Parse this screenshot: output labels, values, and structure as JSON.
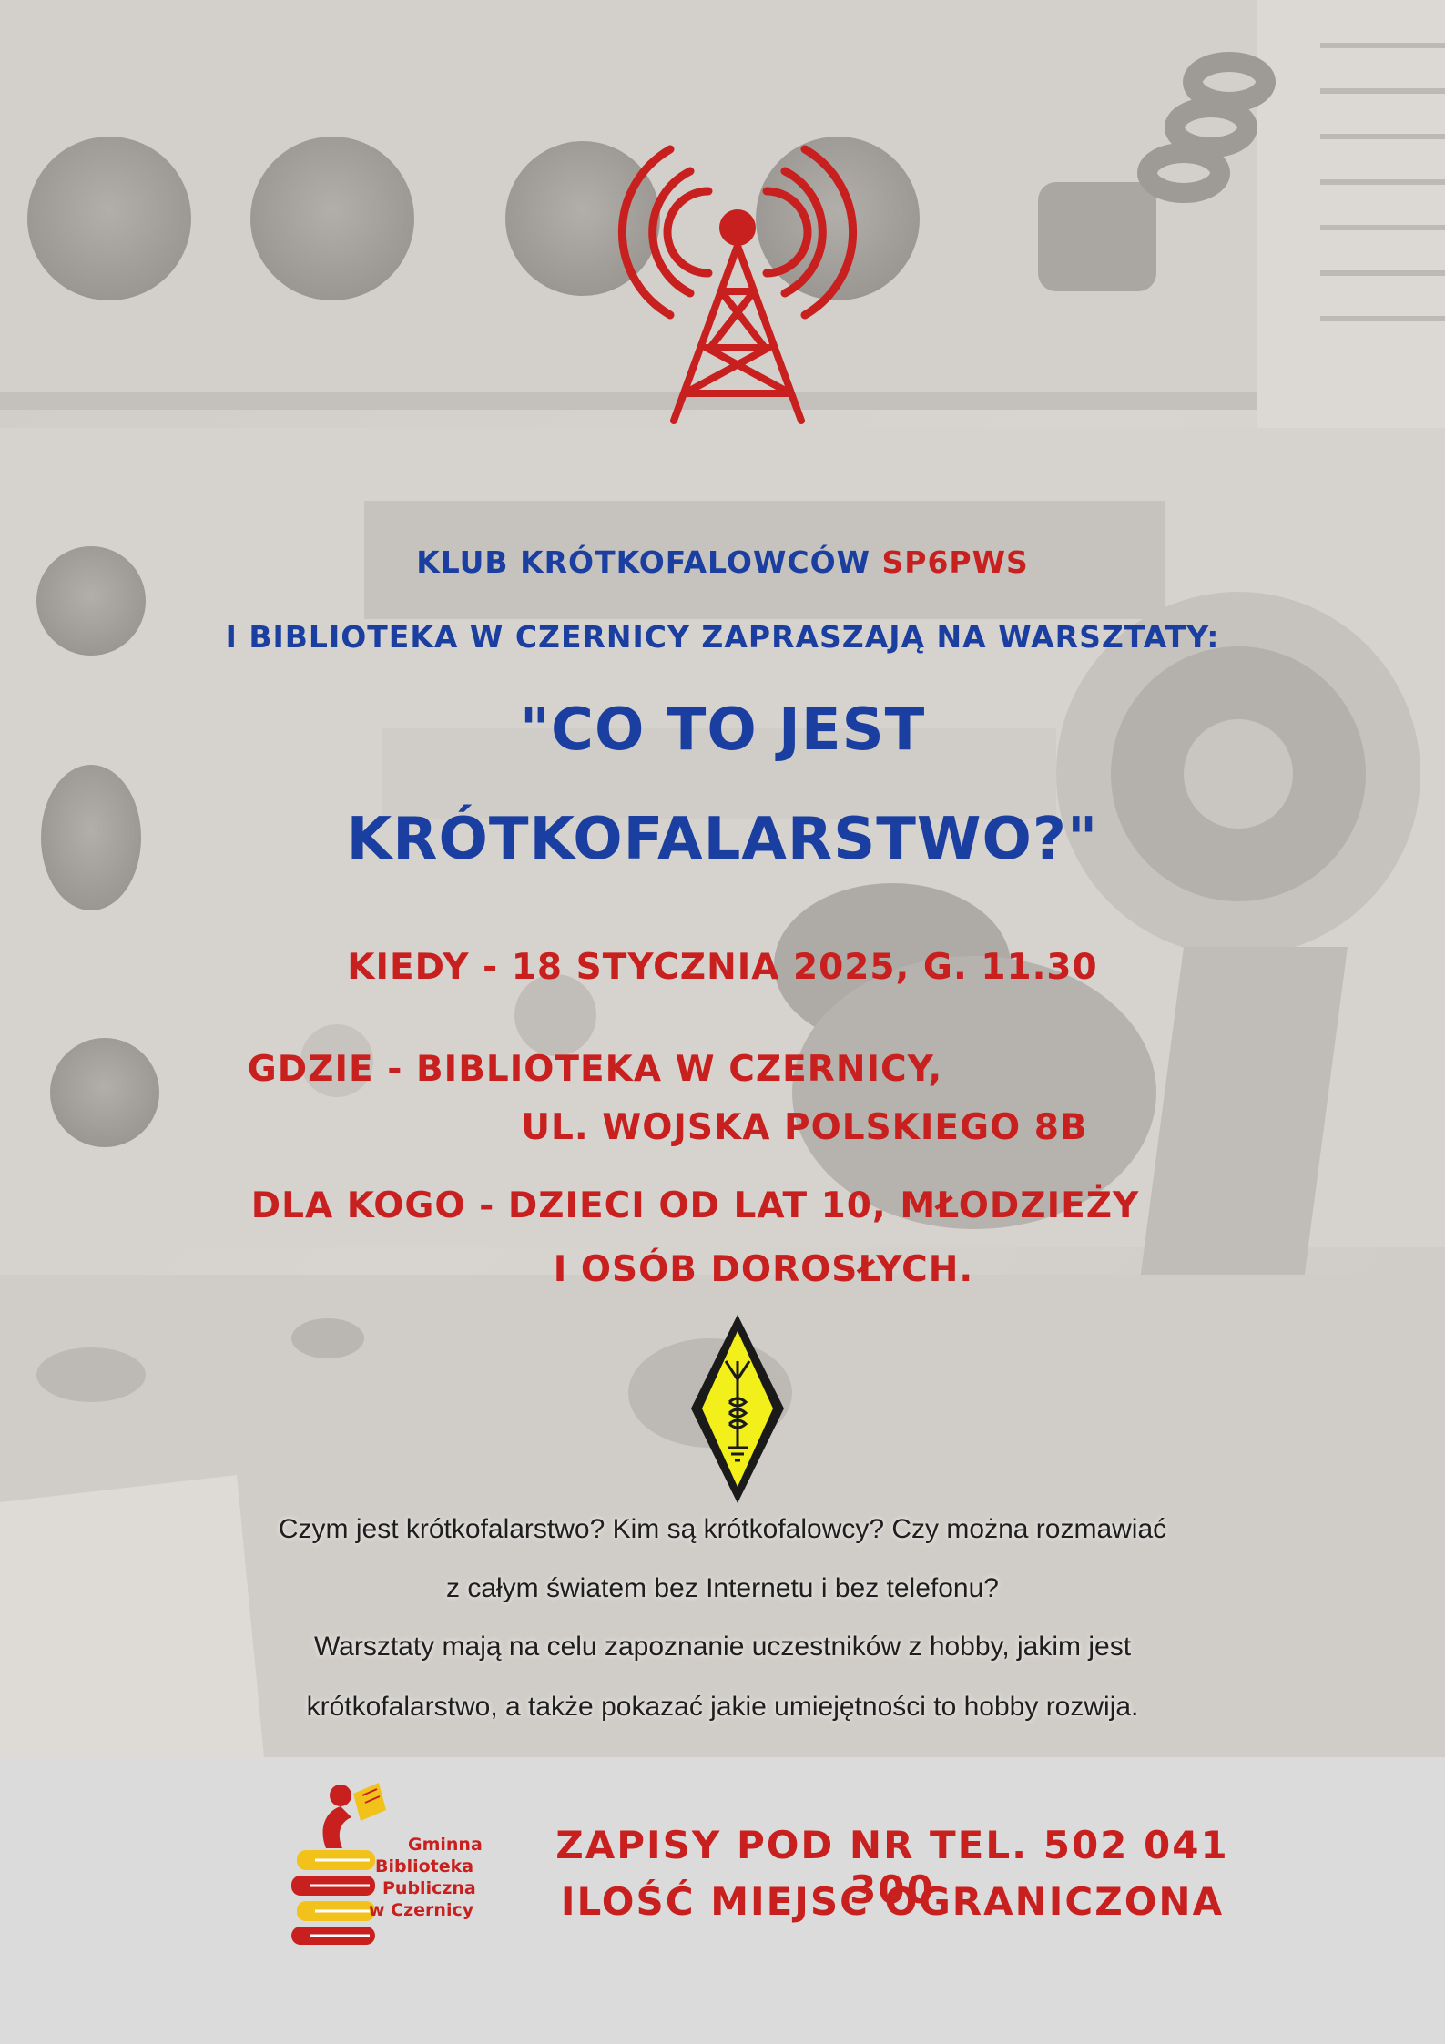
{
  "header": {
    "club_prefix": "KLUB KRÓTKOFALOWCÓW ",
    "club_callsign": "SP6PWS",
    "invite_line": "I BIBLIOTEKA W CZERNICY ZAPRASZAJĄ NA WARSZTATY:"
  },
  "title": {
    "line1": "\"CO TO JEST",
    "line2": "KRÓTKOFALARSTWO?\""
  },
  "details": {
    "when": "KIEDY - 18 STYCZNIA 2025, G. 11.30",
    "where_line1": "GDZIE - BIBLIOTEKA W CZERNICY,",
    "where_line2": "UL. WOJSKA POLSKIEGO 8B",
    "who_line1": "DLA KOGO -  DZIECI OD LAT 10, MŁODZIEŻY",
    "who_line2": "I OSÓB DOROSŁYCH."
  },
  "description": {
    "line1": "Czym jest krótkofalarstwo? Kim są krótkofalowcy? Czy można rozmawiać",
    "line2": "z całym światem bez Internetu i bez telefonu?",
    "line3": "Warsztaty mają na celu zapoznanie uczestników z hobby, jakim jest",
    "line4": "krótkofalarstwo, a także pokazać jakie umiejętności to hobby rozwija."
  },
  "footer": {
    "signup": "ZAPISY POD NR TEL. 502 041 300",
    "limited": "ILOŚĆ MIEJSC OGRANICZONA",
    "logo_lines": [
      "Gminna",
      "Biblioteka",
      "Publiczna",
      "w Czernicy"
    ]
  },
  "colors": {
    "blue": "#1b3fa0",
    "red": "#c8201f",
    "yellow": "#f2ef1a",
    "footer_bg": "#dbdbdb"
  },
  "icons": {
    "antenna": "radio-tower-icon",
    "diamond": "amateur-radio-diamond-icon",
    "logo": "library-books-logo"
  }
}
